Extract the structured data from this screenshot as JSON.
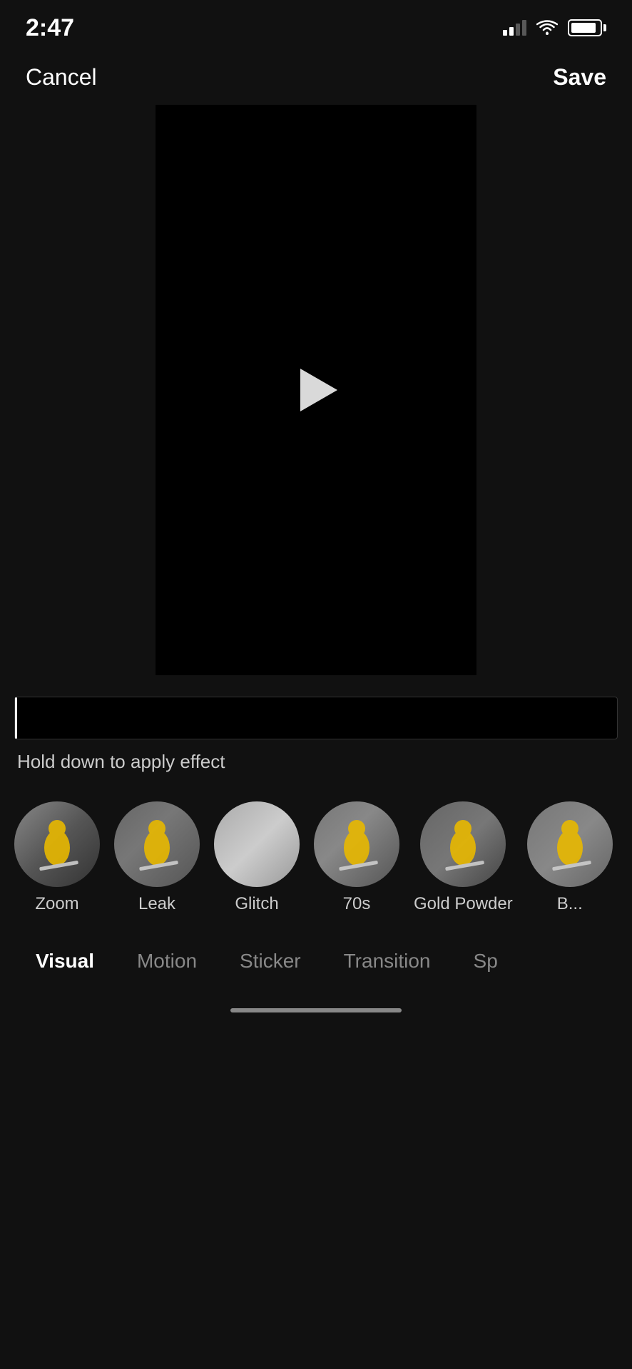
{
  "statusBar": {
    "time": "2:47",
    "battery": "90"
  },
  "topBar": {
    "cancelLabel": "Cancel",
    "saveLabel": "Save"
  },
  "videoPreview": {
    "playButtonAriaLabel": "Play video"
  },
  "timeline": {
    "holdDownText": "Hold down to apply effect"
  },
  "effects": [
    {
      "id": "zoom",
      "label": "Zoom",
      "thumbClass": "effect-thumb-zoom",
      "hasSkier": true
    },
    {
      "id": "leak",
      "label": "Leak",
      "thumbClass": "effect-thumb-leak",
      "hasSkier": true
    },
    {
      "id": "glitch",
      "label": "Glitch",
      "thumbClass": "effect-thumb-glitch",
      "hasSkier": false
    },
    {
      "id": "70s",
      "label": "70s",
      "thumbClass": "effect-thumb-70s",
      "hasSkier": true
    },
    {
      "id": "goldpowder",
      "label": "Gold Powder",
      "thumbClass": "effect-thumb-goldpowder",
      "hasSkier": true
    },
    {
      "id": "partial",
      "label": "B...",
      "thumbClass": "effect-thumb-partial",
      "hasSkier": true
    }
  ],
  "categoryTabs": [
    {
      "id": "visual",
      "label": "Visual",
      "active": true
    },
    {
      "id": "motion",
      "label": "Motion",
      "active": false
    },
    {
      "id": "sticker",
      "label": "Sticker",
      "active": false
    },
    {
      "id": "transition",
      "label": "Transition",
      "active": false
    },
    {
      "id": "sp",
      "label": "Sp",
      "active": false
    }
  ]
}
